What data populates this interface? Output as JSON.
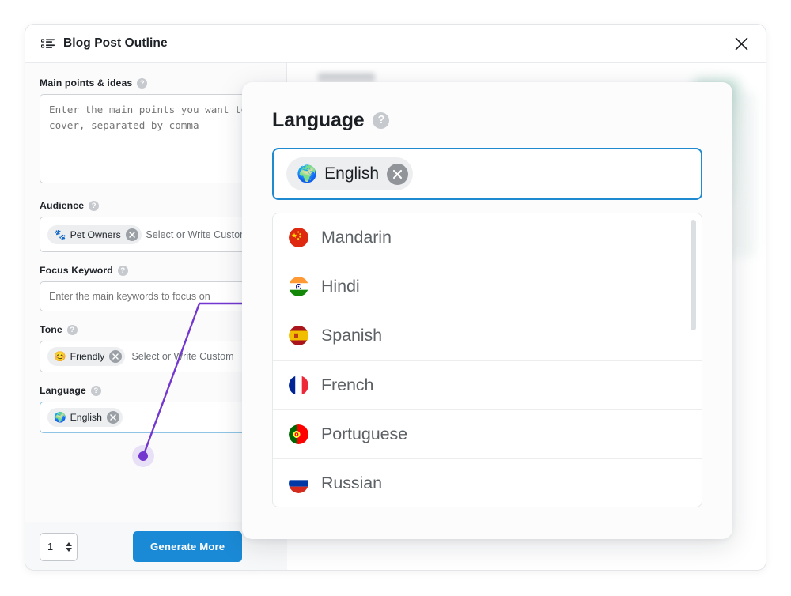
{
  "window": {
    "title": "Blog Post Outline",
    "title_icon": "outline-list-icon",
    "close_icon": "close-icon"
  },
  "form": {
    "fields": [
      {
        "label": "Main points & ideas",
        "help_icon": "help-icon",
        "type": "textarea",
        "placeholder": "Enter the main points you want to cover, separated by comma",
        "value": ""
      },
      {
        "label": "Audience",
        "help_icon": "help-icon",
        "type": "tags",
        "chips": [
          {
            "emoji": "🐾",
            "label": "Pet Owners",
            "remove_icon": "close-icon"
          }
        ],
        "placeholder": "Select or Write Custom"
      },
      {
        "label": "Focus Keyword",
        "help_icon": "help-icon",
        "type": "text",
        "placeholder": "Enter the main keywords to focus on",
        "value": ""
      },
      {
        "label": "Tone",
        "help_icon": "help-icon",
        "type": "tags",
        "chips": [
          {
            "emoji": "😊",
            "label": "Friendly",
            "remove_icon": "close-icon"
          }
        ],
        "placeholder": "Select or Write Custom"
      },
      {
        "label": "Language",
        "help_icon": "help-icon",
        "type": "tags",
        "chips": [
          {
            "emoji": "🌍",
            "label": "English",
            "remove_icon": "close-icon"
          }
        ],
        "placeholder": ""
      }
    ]
  },
  "footer": {
    "count_value": "1",
    "stepper_up_icon": "chevron-up-icon",
    "stepper_down_icon": "chevron-down-icon",
    "generate_label": "Generate More"
  },
  "language_popover": {
    "heading": "Language",
    "help_icon": "help-icon",
    "selected": {
      "emoji": "🌍",
      "label": "English",
      "remove_icon": "close-icon"
    },
    "options": [
      {
        "flag": "flag-china-icon",
        "label": "Mandarin"
      },
      {
        "flag": "flag-india-icon",
        "label": "Hindi"
      },
      {
        "flag": "flag-spain-icon",
        "label": "Spanish"
      },
      {
        "flag": "flag-france-icon",
        "label": "French"
      },
      {
        "flag": "flag-portugal-icon",
        "label": "Portuguese"
      },
      {
        "flag": "flag-russia-icon",
        "label": "Russian"
      }
    ]
  },
  "colors": {
    "accent_blue": "#1b8ad6",
    "focus_border": "#1f8ad0",
    "annotation_purple": "#7337d0",
    "chip_bg": "#edeef0",
    "page_bg": "#ffffff"
  }
}
